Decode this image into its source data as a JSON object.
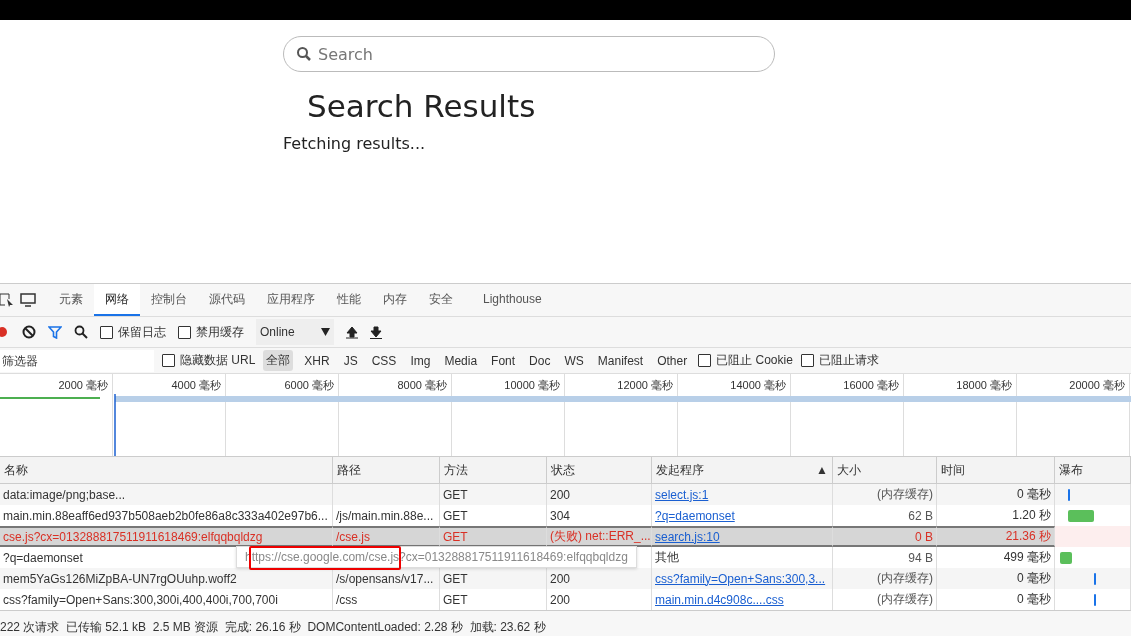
{
  "page": {
    "search": {
      "placeholder": "Search"
    },
    "heading": "Search Results",
    "status": "Fetching results..."
  },
  "devtools": {
    "tabs": [
      {
        "label": "元素",
        "selected": false
      },
      {
        "label": "网络",
        "selected": true
      },
      {
        "label": "控制台",
        "selected": false
      },
      {
        "label": "源代码",
        "selected": false
      },
      {
        "label": "应用程序",
        "selected": false
      },
      {
        "label": "性能",
        "selected": false
      },
      {
        "label": "内存",
        "selected": false
      },
      {
        "label": "安全",
        "selected": false
      },
      {
        "label": "Lighthouse",
        "selected": false
      }
    ],
    "toolbar": {
      "preserve_log": {
        "label": "保留日志",
        "checked": false
      },
      "disable_cache": {
        "label": "禁用缓存",
        "checked": false
      },
      "throttling": "Online"
    },
    "filter": {
      "placeholder": "筛选器",
      "hide_data_urls": {
        "label": "隐藏数据 URL",
        "checked": false
      },
      "types": [
        {
          "label": "全部",
          "selected": true
        },
        {
          "label": "XHR",
          "selected": false
        },
        {
          "label": "JS",
          "selected": false
        },
        {
          "label": "CSS",
          "selected": false
        },
        {
          "label": "Img",
          "selected": false
        },
        {
          "label": "Media",
          "selected": false
        },
        {
          "label": "Font",
          "selected": false
        },
        {
          "label": "Doc",
          "selected": false
        },
        {
          "label": "WS",
          "selected": false
        },
        {
          "label": "Manifest",
          "selected": false
        },
        {
          "label": "Other",
          "selected": false
        }
      ],
      "blocked_cookies": {
        "label": "已阻止 Cookie",
        "checked": false
      },
      "blocked_requests": {
        "label": "已阻止请求",
        "checked": false
      }
    },
    "timeline": [
      "2000 毫秒",
      "4000 毫秒",
      "6000 毫秒",
      "8000 毫秒",
      "10000 毫秒",
      "12000 毫秒",
      "14000 毫秒",
      "16000 毫秒",
      "18000 毫秒",
      "20000 毫秒"
    ],
    "table": {
      "columns": [
        "名称",
        "路径",
        "方法",
        "状态",
        "发起程序",
        "大小",
        "时间",
        "瀑布"
      ],
      "sort_column_mark": "▲",
      "rows": [
        {
          "name": "data:image/png;base...",
          "path": "",
          "method": "GET",
          "status": "200",
          "initiator": "select.js:1",
          "initiator_link": true,
          "size": "(内存缓存)",
          "time": "0 毫秒",
          "failed": false,
          "selected": false
        },
        {
          "name": "main.min.88eaff6ed937b508aeb2b0fe86a8c333a402e97b6...",
          "path": "/js/main.min.88e...",
          "method": "GET",
          "status": "304",
          "initiator": "?q=daemonset",
          "initiator_link": true,
          "size": "62 B",
          "time": "1.20 秒",
          "failed": false,
          "selected": false
        },
        {
          "name": "cse.js?cx=013288817511911618469:elfqqbqldzg",
          "path": "/cse.js",
          "method": "GET",
          "status": "(失败) net::ERR_...",
          "initiator": "search.js:10",
          "initiator_link": true,
          "size": "0 B",
          "time": "21.36 秒",
          "failed": true,
          "selected": true
        },
        {
          "name": "?q=daemonset",
          "initiator": "其他",
          "initiator_link": false,
          "size": "94 B",
          "time": "499 毫秒",
          "failed": false,
          "selected": false
        },
        {
          "name": "mem5YaGs126MiZpBA-UN7rgOUuhp.woff2",
          "path": "/s/opensans/v17...",
          "method": "GET",
          "status": "200",
          "initiator": "css?family=Open+Sans:300,3...",
          "initiator_link": true,
          "size": "(内存缓存)",
          "time": "0 毫秒",
          "failed": false,
          "selected": false
        },
        {
          "name": "css?family=Open+Sans:300,300i,400,400i,700,700i",
          "path": "/css",
          "method": "GET",
          "status": "200",
          "initiator": "main.min.d4c908c....css",
          "initiator_link": true,
          "size": "(内存缓存)",
          "time": "0 毫秒",
          "failed": false,
          "selected": false
        }
      ]
    },
    "tooltip": "https://cse.google.com/cse.js?cx=013288817511911618469:elfqqbqldzg",
    "summary": "222 次请求  已传输 52.1 kB  2.5 MB 资源  完成: 26.16 秒  DOMContentLoaded: 2.28 秒  加载: 23.62 秒"
  }
}
